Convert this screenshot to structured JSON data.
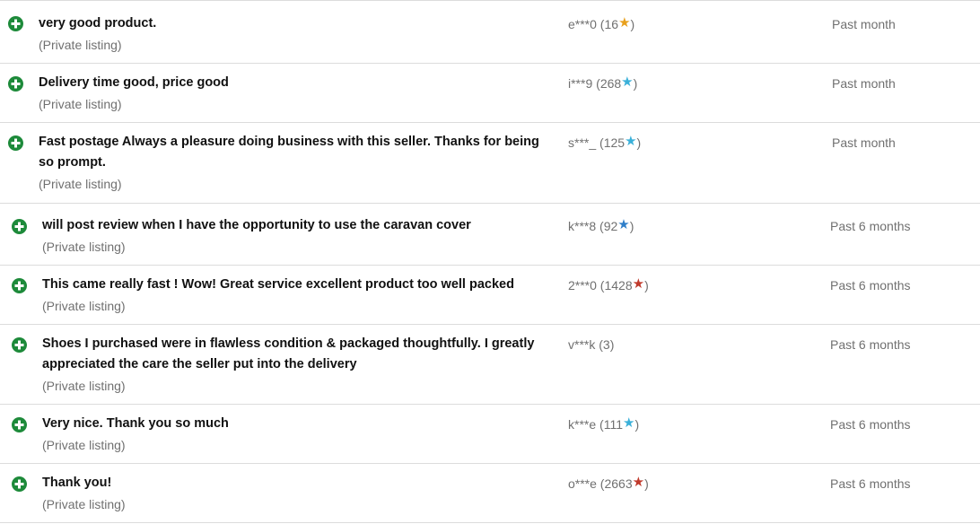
{
  "feedback": [
    {
      "comment": "very good product.",
      "listing": "(Private listing)",
      "buyer": "e***0",
      "score": "16",
      "star_color": "#e8a01c",
      "period": "Past month"
    },
    {
      "comment": "Delivery time good, price good",
      "listing": "(Private listing)",
      "buyer": "i***9",
      "score": "268",
      "star_color": "#3ab0d9",
      "period": "Past month"
    },
    {
      "comment_lines": [
        "Fast postage Always a pleasure doing business with this seller. Thanks for being",
        "so prompt."
      ],
      "listing": "(Private listing)",
      "buyer": "s***_",
      "score": "125",
      "star_color": "#3ab0d9",
      "period": "Past month"
    },
    {
      "comment": "will post review when I have the opportunity to use the caravan cover",
      "listing": "(Private listing)",
      "buyer": "k***8",
      "score": "92",
      "star_color": "#2e7ec9",
      "period": "Past 6 months"
    },
    {
      "comment": "This came really fast ! Wow! Great service excellent product too well packed",
      "listing": "(Private listing)",
      "buyer": "2***0",
      "score": "1428",
      "star_color": "#c0392b",
      "period": "Past 6 months"
    },
    {
      "comment_lines": [
        "Shoes I purchased were in flawless condition & packaged thoughtfully. I greatly",
        "appreciated the care the seller put into the delivery"
      ],
      "listing": "(Private listing)",
      "buyer": "v***k",
      "score": "3",
      "star_color": "",
      "period": "Past 6 months"
    },
    {
      "comment": "Very nice. Thank you so much",
      "listing": "(Private listing)",
      "buyer": "k***e",
      "score": "111",
      "star_color": "#3ab0d9",
      "period": "Past 6 months"
    },
    {
      "comment": "Thank you!",
      "listing": "(Private listing)",
      "buyer": "o***e",
      "score": "2663",
      "star_color": "#c0392b",
      "period": "Past 6 months"
    }
  ],
  "icons": {
    "positive": "plus-circle-icon",
    "feedback_star": "star-icon"
  },
  "colors": {
    "positive_green": "#1d8a3a",
    "divider": "#dcdcdc",
    "muted_text": "#707070"
  }
}
